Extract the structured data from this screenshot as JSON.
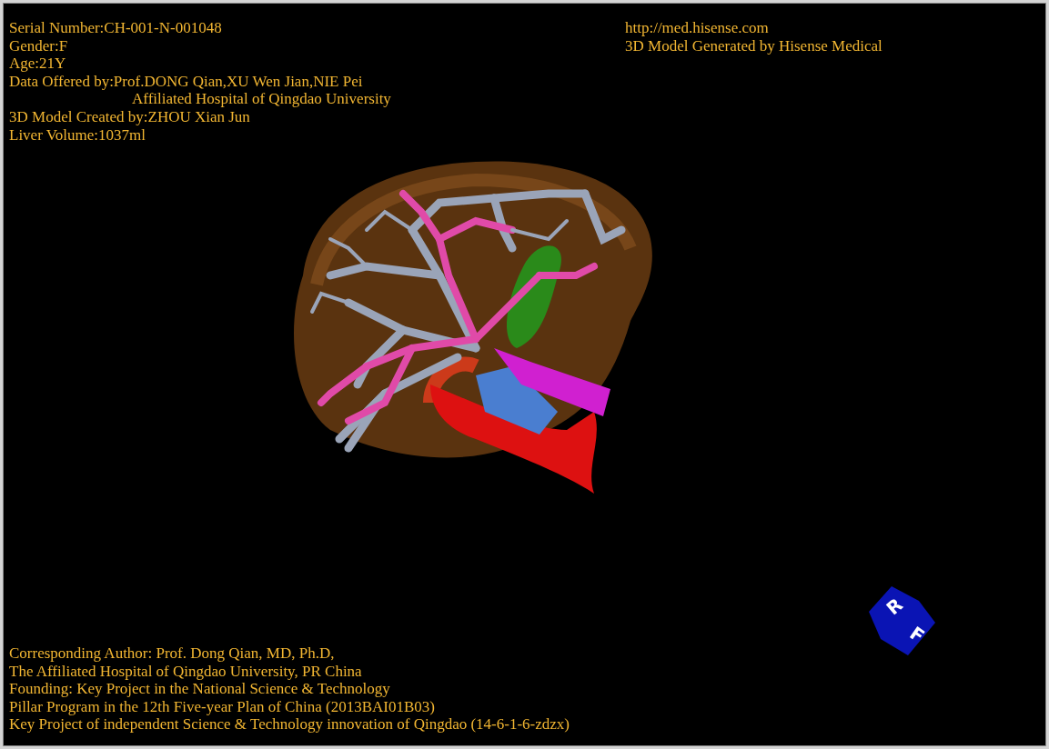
{
  "patient_info": [
    {
      "kind": "line",
      "text": "Serial Number:CH-001-N-001048"
    },
    {
      "kind": "line",
      "text": "Gender:F"
    },
    {
      "kind": "line",
      "text": "Age:21Y"
    },
    {
      "kind": "line",
      "text": "Data Offered by:Prof.DONG Qian,XU Wen Jian,NIE Pei"
    },
    {
      "kind": "continuation",
      "text": "Affiliated Hospital of Qingdao University"
    },
    {
      "kind": "line",
      "text": "3D Model Created by:ZHOU Xian Jun"
    },
    {
      "kind": "line",
      "text": "Liver Volume:1037ml"
    }
  ],
  "source_info": [
    "http://med.hisense.com",
    "3D Model Generated by Hisense Medical"
  ],
  "orientation_cube": {
    "faces": [
      "R",
      "F"
    ]
  },
  "credits": [
    "Corresponding Author: Prof. Dong Qian, MD, Ph.D,",
    "The Affiliated Hospital of Qingdao University, PR China",
    "Founding: Key Project in the National Science & Technology",
    "Pillar Program in the 12th Five-year Plan of China (2013BAI01B03)",
    "Key Project of independent Science & Technology innovation of Qingdao (14-6-1-6-zdzx)"
  ]
}
